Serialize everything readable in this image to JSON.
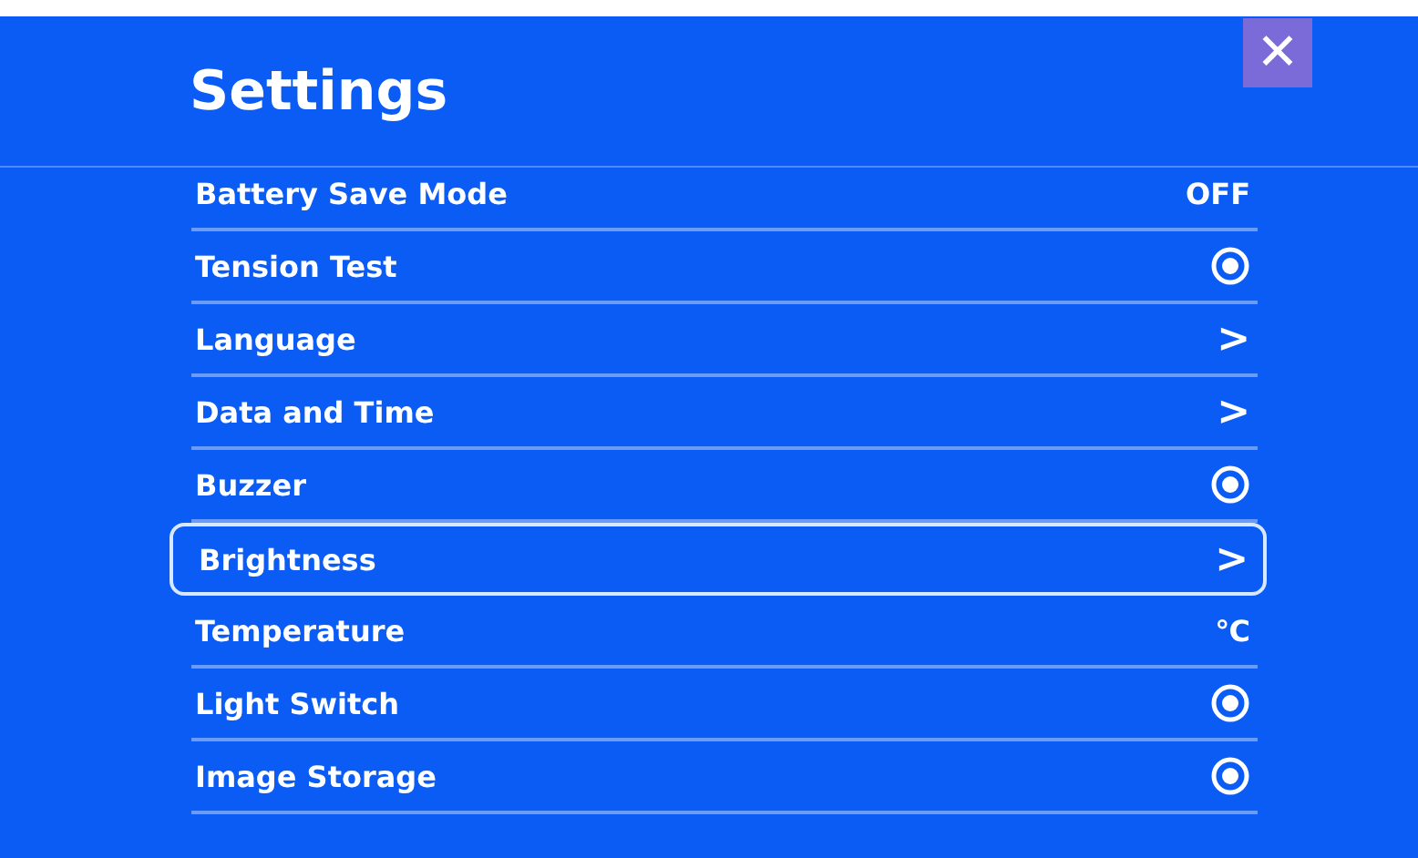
{
  "window": {
    "title": "Settings",
    "close": "✕"
  },
  "items": [
    {
      "label": "Battery Save Mode",
      "kind": "value",
      "value": "OFF",
      "selected": false
    },
    {
      "label": "Tension Test",
      "kind": "radio",
      "on": true,
      "selected": false
    },
    {
      "label": "Language",
      "kind": "chevron",
      "value": ">",
      "selected": false
    },
    {
      "label": "Data and Time",
      "kind": "chevron",
      "value": ">",
      "selected": false
    },
    {
      "label": "Buzzer",
      "kind": "radio",
      "on": true,
      "selected": false
    },
    {
      "label": "Brightness",
      "kind": "chevron",
      "value": ">",
      "selected": true
    },
    {
      "label": "Temperature",
      "kind": "value",
      "value": "℃",
      "selected": false
    },
    {
      "label": "Light Switch",
      "kind": "radio",
      "on": true,
      "selected": false
    },
    {
      "label": "Image Storage",
      "kind": "radio",
      "on": true,
      "selected": false
    }
  ]
}
